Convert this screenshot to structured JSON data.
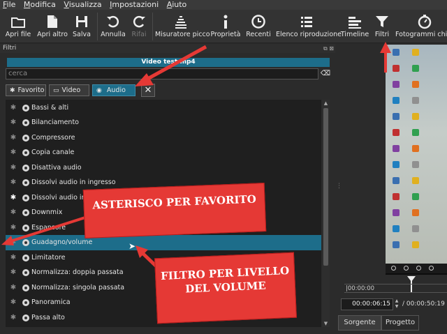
{
  "menu": [
    "File",
    "Modifica",
    "Visualizza",
    "Impostazioni",
    "Aiuto"
  ],
  "toolbar": {
    "apri_file": "Apri file",
    "apri_altro": "Apri altro",
    "salva": "Salva",
    "annulla": "Annulla",
    "rifai": "Rifai",
    "misuratore": "Misuratore picco",
    "proprieta": "Proprietà",
    "recenti": "Recenti",
    "elenco": "Elenco riproduzione",
    "timeline": "Timeline",
    "filtri": "Filtri",
    "fotogrammi": "Fotogrammi chiav"
  },
  "panel": {
    "title": "Filtri",
    "controls": "⧉ ⊠",
    "clip_name": "Video test.mp4",
    "search_placeholder": "cerca",
    "clear_icon": "⌫",
    "tabs": {
      "favorito": "Favorito",
      "video": "Video",
      "audio": "Audio"
    },
    "close": "✕"
  },
  "filters": [
    {
      "name": "Bassi & alti",
      "fav": false
    },
    {
      "name": "Bilanciamento",
      "fav": false
    },
    {
      "name": "Compressore",
      "fav": false
    },
    {
      "name": "Copia canale",
      "fav": false
    },
    {
      "name": "Disattiva audio",
      "fav": false
    },
    {
      "name": "Dissolvi audio in ingresso",
      "fav": false
    },
    {
      "name": "Dissolvi audio in uscita",
      "fav": true
    },
    {
      "name": "Downmix",
      "fav": false
    },
    {
      "name": "Espansore",
      "fav": false
    },
    {
      "name": "Guadagno/volume",
      "fav": false,
      "selected": true
    },
    {
      "name": "Limitatore",
      "fav": false
    },
    {
      "name": "Normalizza: doppia passata",
      "fav": false
    },
    {
      "name": "Normalizza: singola passata",
      "fav": false
    },
    {
      "name": "Panoramica",
      "fav": false
    },
    {
      "name": "Passa alto",
      "fav": false
    }
  ],
  "player": {
    "ruler_start": "|00:00:00",
    "position": "00:00:06:15",
    "total": "/ 00:00:50:19",
    "tab_source": "Sorgente",
    "tab_project": "Progetto"
  },
  "annotations": {
    "callout1": "ASTERISCO PER FAVORITO",
    "callout2": "FILTRO PER LIVELLO DEL VOLUME"
  },
  "colors": {
    "accent": "#1d6d8a",
    "callout": "#e53935"
  }
}
